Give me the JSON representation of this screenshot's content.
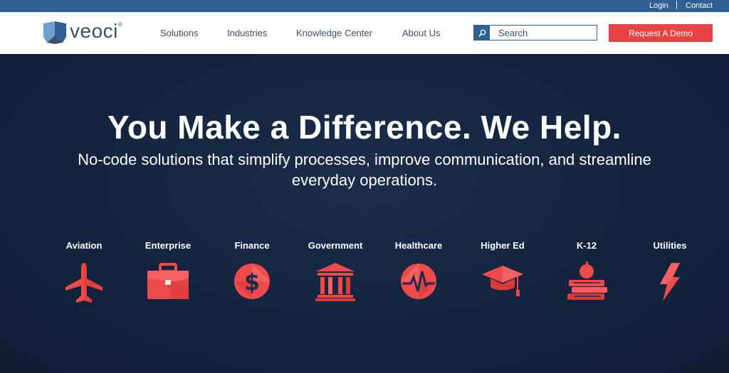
{
  "topbar": {
    "login": "Login",
    "contact": "Contact"
  },
  "brand": {
    "name": "veoci",
    "reg": "®",
    "logo_icon": "veoci-shield-logo"
  },
  "nav": {
    "items": [
      "Solutions",
      "Industries",
      "Knowledge Center",
      "About Us"
    ]
  },
  "search": {
    "placeholder": "Search",
    "icon": "search-icon"
  },
  "cta": {
    "label": "Request A Demo"
  },
  "hero": {
    "title": "You Make a Difference. We Help.",
    "subtitle": "No-code solutions that simplify processes, improve communication, and streamline everyday operations."
  },
  "industries": [
    {
      "label": "Aviation",
      "icon": "airplane-icon"
    },
    {
      "label": "Enterprise",
      "icon": "briefcase-icon"
    },
    {
      "label": "Finance",
      "icon": "dollar-icon"
    },
    {
      "label": "Government",
      "icon": "government-building-icon"
    },
    {
      "label": "Healthcare",
      "icon": "heartbeat-icon"
    },
    {
      "label": "Higher Ed",
      "icon": "graduation-cap-icon"
    },
    {
      "label": "K-12",
      "icon": "apple-books-icon"
    },
    {
      "label": "Utilities",
      "icon": "lightning-bolt-icon"
    }
  ],
  "colors": {
    "topbar": "#2f5f93",
    "brand_dark": "#3a4f68",
    "accent_red": "#e84343",
    "hero_bg": "#13233d",
    "white": "#ffffff"
  }
}
